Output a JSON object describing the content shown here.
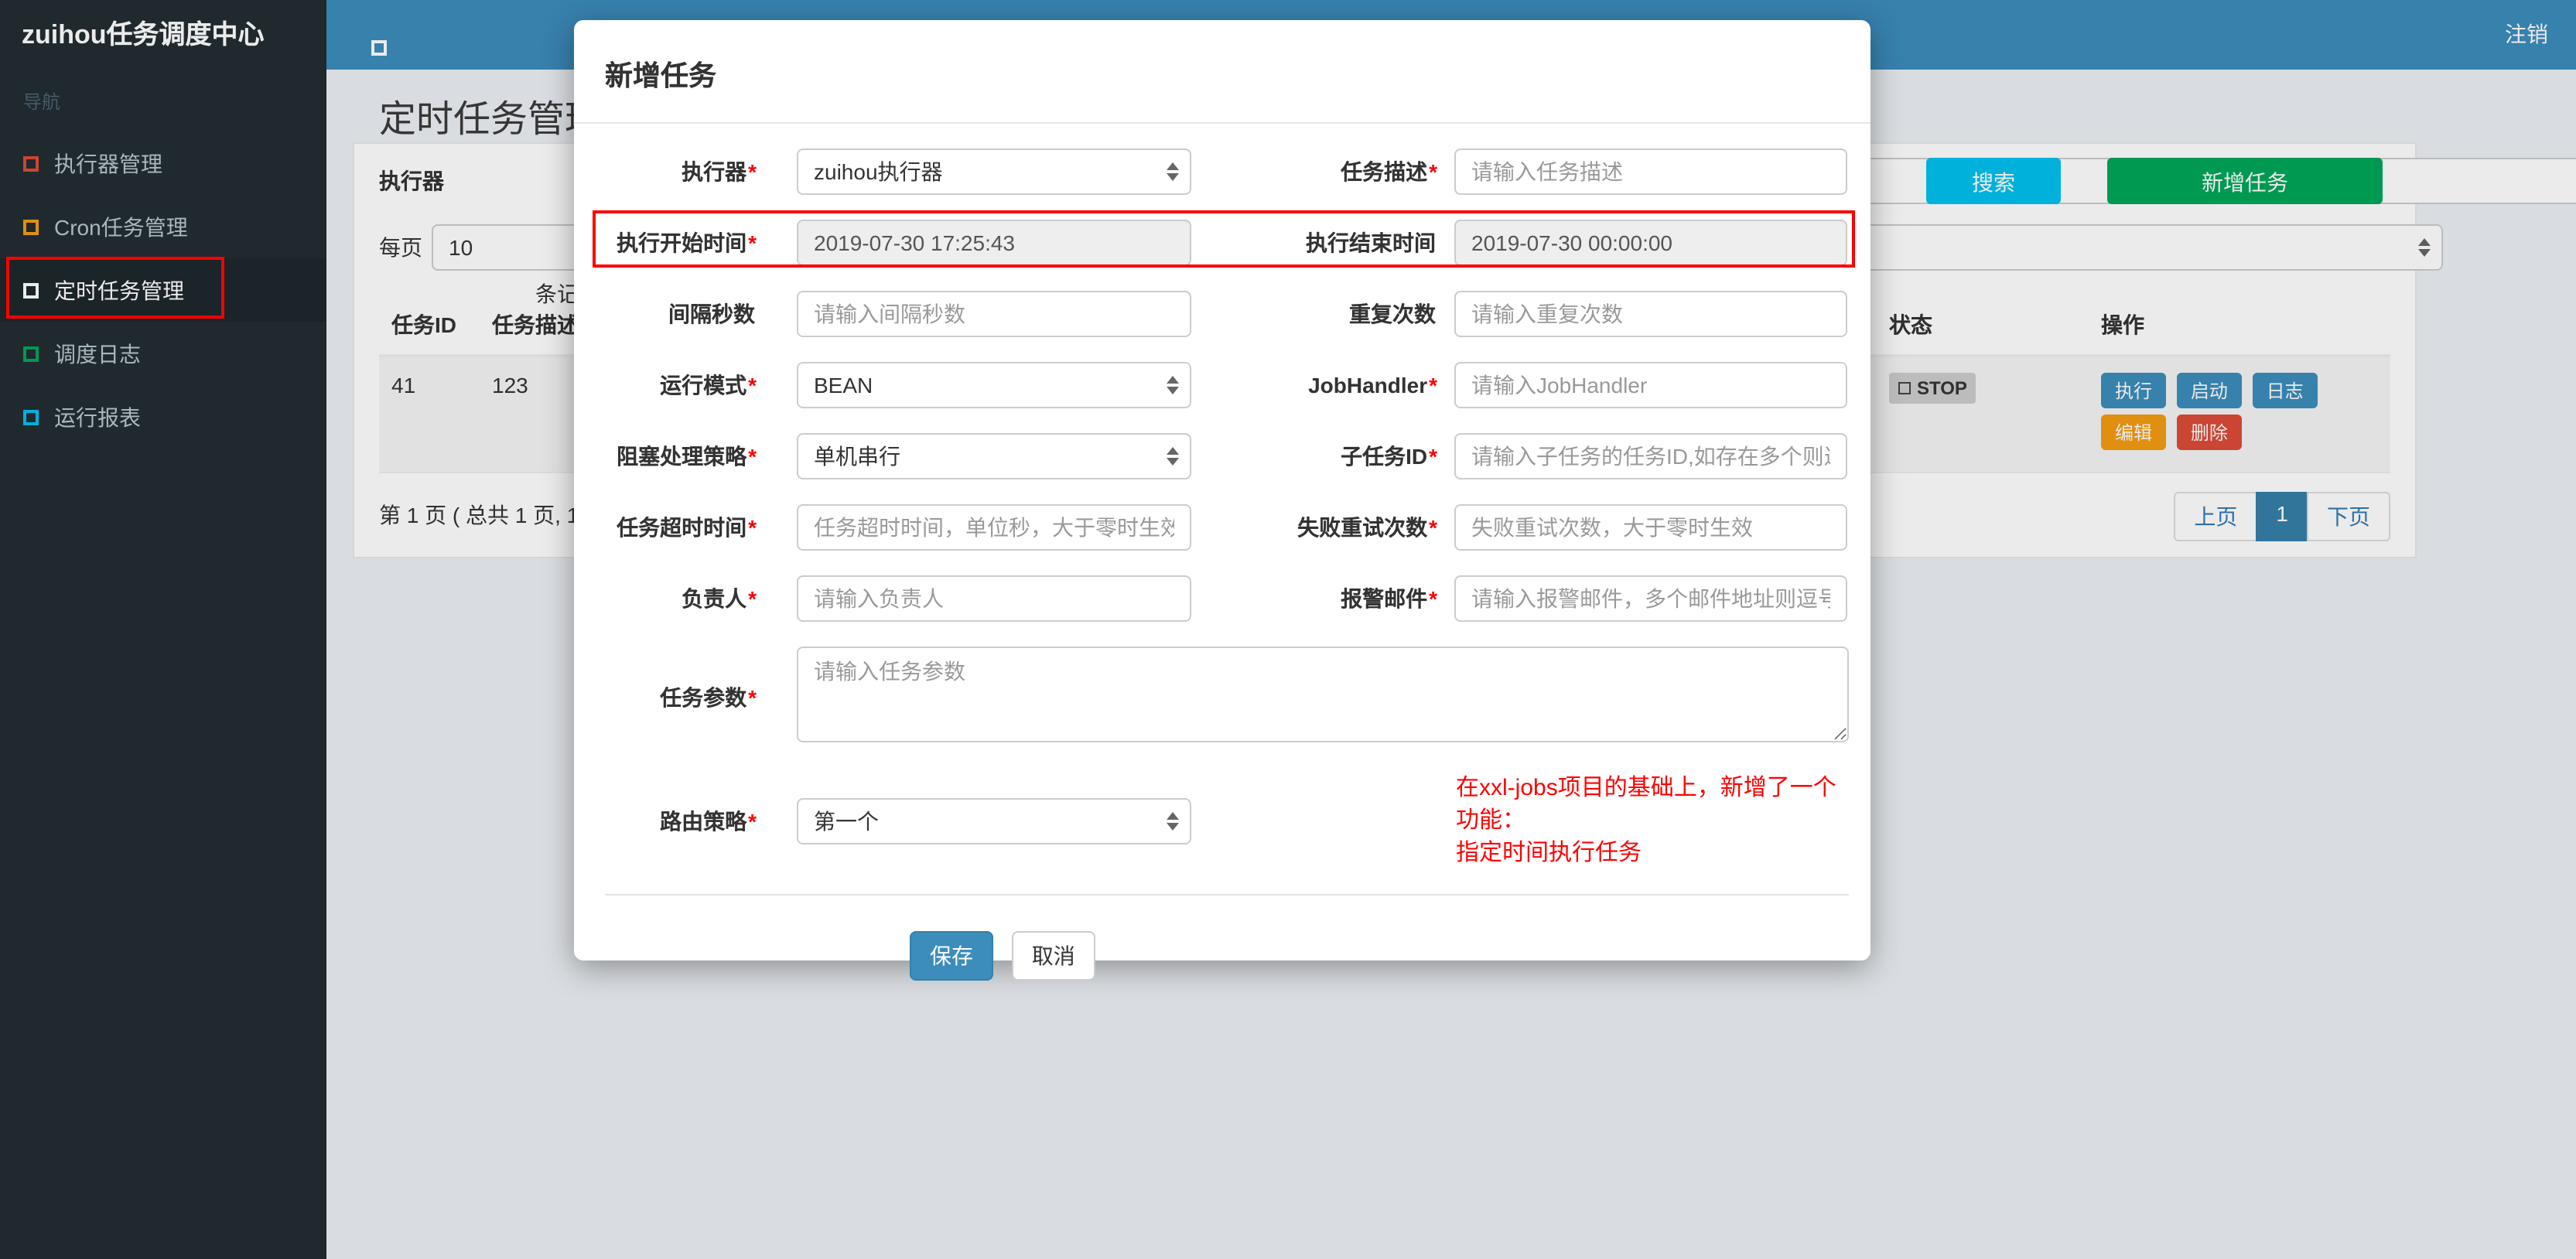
{
  "navbar": {
    "brand": "zuihou任务调度中心",
    "logout": "注销"
  },
  "sidebar": {
    "header": "导航",
    "items": [
      {
        "label": "执行器管理",
        "color": "#dd4b39"
      },
      {
        "label": "Cron任务管理",
        "color": "#f39c12"
      },
      {
        "label": "定时任务管理",
        "color": "#ffffff"
      },
      {
        "label": "调度日志",
        "color": "#00a65a"
      },
      {
        "label": "运行报表",
        "color": "#00c0ef"
      }
    ]
  },
  "page": {
    "title": "定时任务管理",
    "filter": {
      "executor_label": "执行器",
      "input_value": "",
      "search": "搜索",
      "add": "新增任务"
    },
    "per_page": {
      "label": "每页",
      "value": "10",
      "suffix": "条记录"
    },
    "table": {
      "headers": {
        "id": "任务ID",
        "desc": "任务描述",
        "status": "状态",
        "actions": "操作"
      },
      "rows": [
        {
          "id": "41",
          "desc": "123",
          "status": "STOP",
          "actions": [
            "执行",
            "启动",
            "日志",
            "编辑",
            "删除"
          ]
        }
      ]
    },
    "pagination": {
      "info": "第 1 页 ( 总共 1 页, 1",
      "prev": "上页",
      "page": "1",
      "next": "下页"
    }
  },
  "modal": {
    "title": "新增任务",
    "fields": {
      "executor": {
        "label": "执行器",
        "star": "*",
        "value": "zuihou执行器"
      },
      "job_desc": {
        "label": "任务描述",
        "star": "*",
        "placeholder": "请输入任务描述"
      },
      "start_time": {
        "label": "执行开始时间",
        "star": "*",
        "value": "2019-07-30 17:25:43"
      },
      "end_time": {
        "label": "执行结束时间",
        "star": "",
        "value": "2019-07-30 00:00:00"
      },
      "interval": {
        "label": "间隔秒数",
        "star": "",
        "placeholder": "请输入间隔秒数"
      },
      "repeat": {
        "label": "重复次数",
        "star": "",
        "placeholder": "请输入重复次数"
      },
      "run_mode": {
        "label": "运行模式",
        "star": "*",
        "value": "BEAN"
      },
      "job_handler": {
        "label": "JobHandler",
        "star": "*",
        "placeholder": "请输入JobHandler"
      },
      "block_strategy": {
        "label": "阻塞处理策略",
        "star": "*",
        "value": "单机串行"
      },
      "child_job": {
        "label": "子任务ID",
        "star": "*",
        "placeholder": "请输入子任务的任务ID,如存在多个则逗号分隔"
      },
      "timeout": {
        "label": "任务超时时间",
        "star": "*",
        "placeholder": "任务超时时间，单位秒，大于零时生效"
      },
      "retry": {
        "label": "失败重试次数",
        "star": "*",
        "placeholder": "失败重试次数，大于零时生效"
      },
      "owner": {
        "label": "负责人",
        "star": "*",
        "placeholder": "请输入负责人"
      },
      "alarm_email": {
        "label": "报警邮件",
        "star": "*",
        "placeholder": "请输入报警邮件，多个邮件地址则逗号分隔"
      },
      "job_param": {
        "label": "任务参数",
        "star": "*",
        "placeholder": "请输入任务参数"
      },
      "route_strategy": {
        "label": "路由策略",
        "star": "*",
        "value": "第一个"
      }
    },
    "note": {
      "line1": "在xxl-jobs项目的基础上，新增了一个功能：",
      "line2": "指定时间执行任务"
    },
    "save": "保存",
    "cancel": "取消"
  },
  "colors": {
    "navbar": "#3c8dbc",
    "brand_bg": "#222d32",
    "sidebar": "#222d32",
    "primary": "#3c8dbc",
    "info": "#00c0ef",
    "success": "#00a65a",
    "warning": "#f39c12",
    "danger": "#dd4b39",
    "annotation": "#ff0000"
  }
}
